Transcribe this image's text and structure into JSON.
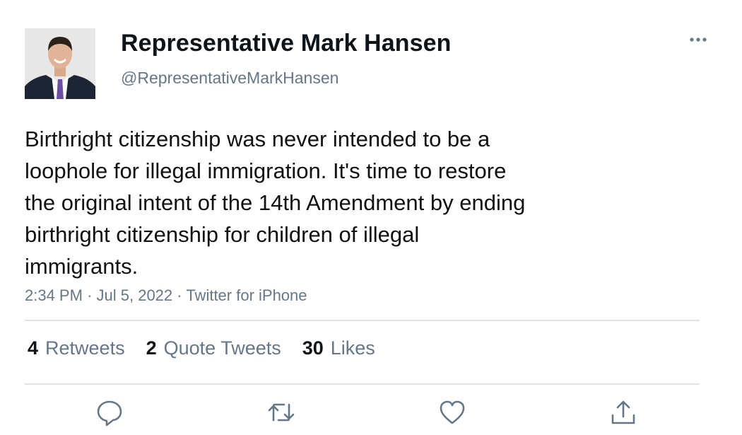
{
  "tweet": {
    "author": {
      "display_name": "Representative Mark Hansen",
      "handle": "@RepresentativeMarkHansen"
    },
    "text_lines": [
      "Birthright citizenship was never intended to be a",
      "loophole for illegal immigration. It's time to restore",
      "the original intent of the 14th Amendment by ending",
      "birthright citizenship for children of illegal",
      "immigrants."
    ],
    "meta": {
      "time": "2:34 PM",
      "separator": "·",
      "date": "Jul 5, 2022",
      "source": "Twitter for iPhone"
    },
    "stats": {
      "retweets": {
        "count": "4",
        "label": "Retweets"
      },
      "quotes": {
        "count": "2",
        "label": "Quote Tweets"
      },
      "likes": {
        "count": "30",
        "label": "Likes"
      }
    },
    "icons": {
      "more": "more-icon",
      "reply": "reply-icon",
      "retweet": "retweet-icon",
      "like": "like-icon",
      "share": "share-icon"
    }
  },
  "colors": {
    "text_primary": "#0f1419",
    "text_secondary": "#657786",
    "divider": "#dfe3e6",
    "icon": "#657786"
  }
}
